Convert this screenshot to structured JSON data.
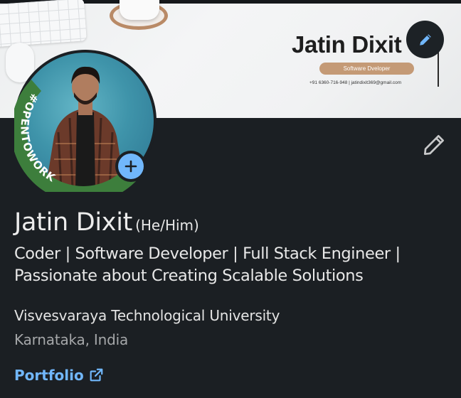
{
  "banner": {
    "name": "Jatin Dixit",
    "role": "Software Dveloper",
    "contact": "+91 6360-716-948  |  jatindixit369@gmail.com"
  },
  "avatar": {
    "badge_text": "#OPENTOWORK"
  },
  "profile": {
    "name": "Jatin Dixit",
    "pronouns": "(He/Him)",
    "headline": "Coder | Software Developer | Full Stack Engineer | Passionate about Creating Scalable Solutions",
    "university": "Visvesvaraya Technological University",
    "location": "Karnataka, India",
    "website_label": "Portfolio"
  },
  "icons": {
    "banner_edit": "pencil-icon",
    "profile_edit": "pencil-icon",
    "add_photo": "plus-icon",
    "external_link": "external-link-icon"
  },
  "colors": {
    "background": "#1b1f23",
    "link_blue": "#71b7fb",
    "open_to_work_green": "#3d7e3c",
    "banner_pill": "#c49a76"
  }
}
